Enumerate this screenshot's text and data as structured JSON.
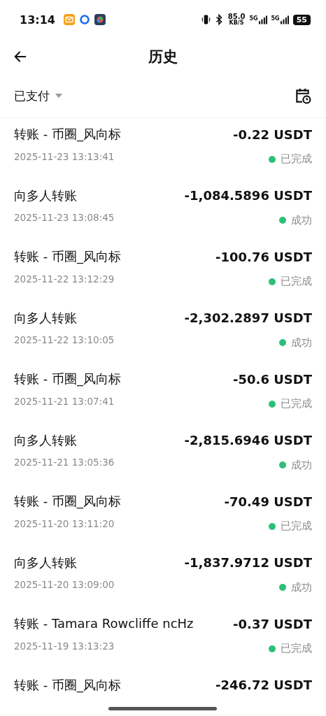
{
  "status_bar": {
    "time": "13:14",
    "net_speed": "85.0",
    "net_unit": "KB/S",
    "signal_1": "5G",
    "signal_2": "5G",
    "battery": "55"
  },
  "header": {
    "title": "历史"
  },
  "filter": {
    "label": "已支付"
  },
  "transactions": [
    {
      "title": "转账 - 币圈_风向标",
      "date": "2025-11-23 13:13:41",
      "amount": "-0.22 USDT",
      "status": "已完成",
      "color": "#2dbf78"
    },
    {
      "title": "向多人转账",
      "date": "2025-11-23 13:08:45",
      "amount": "-1,084.5896 USDT",
      "status": "成功",
      "color": "#2dbf78"
    },
    {
      "title": "转账 - 币圈_风向标",
      "date": "2025-11-22 13:12:29",
      "amount": "-100.76 USDT",
      "status": "已完成",
      "color": "#2dbf78"
    },
    {
      "title": "向多人转账",
      "date": "2025-11-22 13:10:05",
      "amount": "-2,302.2897 USDT",
      "status": "成功",
      "color": "#2dbf78"
    },
    {
      "title": "转账 - 币圈_风向标",
      "date": "2025-11-21 13:07:41",
      "amount": "-50.6 USDT",
      "status": "已完成",
      "color": "#2dbf78"
    },
    {
      "title": "向多人转账",
      "date": "2025-11-21 13:05:36",
      "amount": "-2,815.6946 USDT",
      "status": "成功",
      "color": "#2dbf78"
    },
    {
      "title": "转账 - 币圈_风向标",
      "date": "2025-11-20 13:11:20",
      "amount": "-70.49 USDT",
      "status": "已完成",
      "color": "#2dbf78"
    },
    {
      "title": "向多人转账",
      "date": "2025-11-20 13:09:00",
      "amount": "-1,837.9712 USDT",
      "status": "成功",
      "color": "#2dbf78"
    },
    {
      "title": "转账 - Tamara Rowcliffe ncHz",
      "date": "2025-11-19 13:13:23",
      "amount": "-0.37 USDT",
      "status": "已完成",
      "color": "#2dbf78"
    },
    {
      "title": "转账 - 币圈_风向标",
      "amount": "-246.72 USDT"
    }
  ]
}
